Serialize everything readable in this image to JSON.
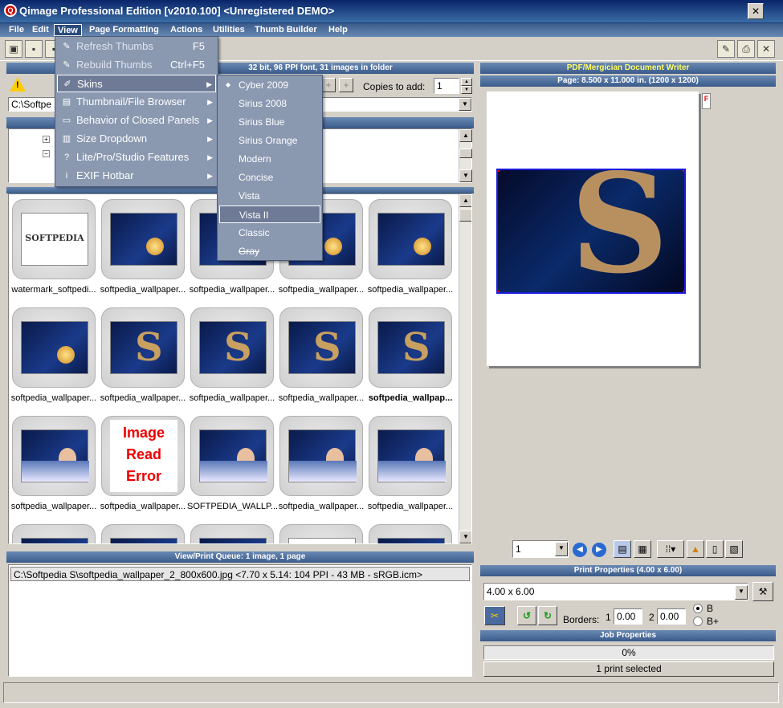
{
  "window": {
    "title": "Qimage Professional Edition [v2010.100] <Unregistered DEMO>",
    "close_glyph": "✕"
  },
  "menubar": [
    "File",
    "Edit",
    "View",
    "Page Formatting",
    "Actions",
    "Utilities",
    "Thumb Builder",
    "Help"
  ],
  "view_menu": {
    "items": [
      {
        "icon": "wrench-icon",
        "glyph": "✎",
        "label": "Refresh Thumbs",
        "shortcut": "F5"
      },
      {
        "icon": "wrench-icon",
        "glyph": "✎",
        "label": "Rebuild Thumbs",
        "shortcut": "Ctrl+F5"
      },
      {
        "icon": "brush-icon",
        "glyph": "✐",
        "label": "Skins",
        "submenu": true
      },
      {
        "icon": "browser-icon",
        "glyph": "▤",
        "label": "Thumbnail/File Browser",
        "submenu": true
      },
      {
        "icon": "tabs-icon",
        "glyph": "▭",
        "label": "Behavior of Closed Panels",
        "submenu": true
      },
      {
        "icon": "size-icon",
        "glyph": "▥",
        "label": "Size Dropdown",
        "submenu": true
      },
      {
        "icon": "help-icon",
        "glyph": "?",
        "label": "Lite/Pro/Studio Features",
        "submenu": true
      },
      {
        "icon": "info-icon",
        "glyph": "i",
        "label": "EXIF Hotbar",
        "submenu": true
      }
    ],
    "arrow": "▶"
  },
  "skins_menu": {
    "selected_glyph": "◆",
    "items": [
      "Cyber 2009",
      "Sirius 2008",
      "Sirius Blue",
      "Sirius Orange",
      "Modern",
      "Concise",
      "Vista",
      "Vista II",
      "Classic",
      "Gray"
    ],
    "active": "Cyber 2009",
    "highlighted": "Vista II"
  },
  "browser": {
    "header": "32 bit, 96 PPI font, 31 images in folder",
    "copies_label": "Copies to add:",
    "copies_value": "1",
    "path": "C:\\Softpe"
  },
  "thumbnails": [
    {
      "label": "watermark_softpedi...",
      "kind": "white",
      "bold": false
    },
    {
      "label": "softpedia_wallpaper...",
      "kind": "moon",
      "bold": false
    },
    {
      "label": "softpedia_wallpaper...",
      "kind": "moon",
      "bold": false
    },
    {
      "label": "softpedia_wallpaper...",
      "kind": "moon",
      "bold": false
    },
    {
      "label": "softpedia_wallpaper...",
      "kind": "moon",
      "bold": false
    },
    {
      "label": "softpedia_wallpaper...",
      "kind": "moon",
      "bold": false
    },
    {
      "label": "softpedia_wallpaper...",
      "kind": "s",
      "bold": false
    },
    {
      "label": "softpedia_wallpaper...",
      "kind": "s",
      "bold": false
    },
    {
      "label": "softpedia_wallpaper...",
      "kind": "s",
      "bold": false
    },
    {
      "label": "softpedia_wallpap...",
      "kind": "s",
      "bold": true
    },
    {
      "label": "softpedia_wallpaper...",
      "kind": "girl",
      "bold": false
    },
    {
      "label": "softpedia_wallpaper...",
      "kind": "error",
      "bold": false
    },
    {
      "label": "SOFTPEDIA_WALLP...",
      "kind": "girl",
      "bold": false
    },
    {
      "label": "softpedia_wallpaper...",
      "kind": "girl",
      "bold": false
    },
    {
      "label": "softpedia_wallpaper...",
      "kind": "girl",
      "bold": false
    }
  ],
  "image_error": [
    "Image",
    "Read",
    "Error"
  ],
  "watermark_logo": "SOFTPEDIA",
  "queue": {
    "header": "View/Print Queue: 1 image, 1 page",
    "item": "C:\\Softpedia S\\softpedia_wallpaper_2_800x600.jpg <7.70 x 5.14:  104 PPI -  43 MB - sRGB.icm>"
  },
  "preview": {
    "printer": "PDF/Mergician Document Writer",
    "page": "Page: 8.500 x 11.000 in.  (1200 x 1200)",
    "page_number": "1",
    "marker": "F"
  },
  "print_props": {
    "header": "Print Properties (4.00 x 6.00)",
    "size": "4.00 x 6.00",
    "borders_label": "Borders:",
    "border1_label": "1",
    "border1_value": "0.00",
    "border2_label": "2",
    "border2_value": "0.00",
    "radio_b": "B",
    "radio_bplus": "B+"
  },
  "job": {
    "header": "Job Properties",
    "progress": "0%",
    "progress_fraction": 0,
    "status": "1 print selected"
  },
  "colors": {
    "title_bar": "#0a246a",
    "menu_bar": "#3a5a8a",
    "dropdown": "#8a98b0",
    "selection_border": "#1a1ae0"
  }
}
